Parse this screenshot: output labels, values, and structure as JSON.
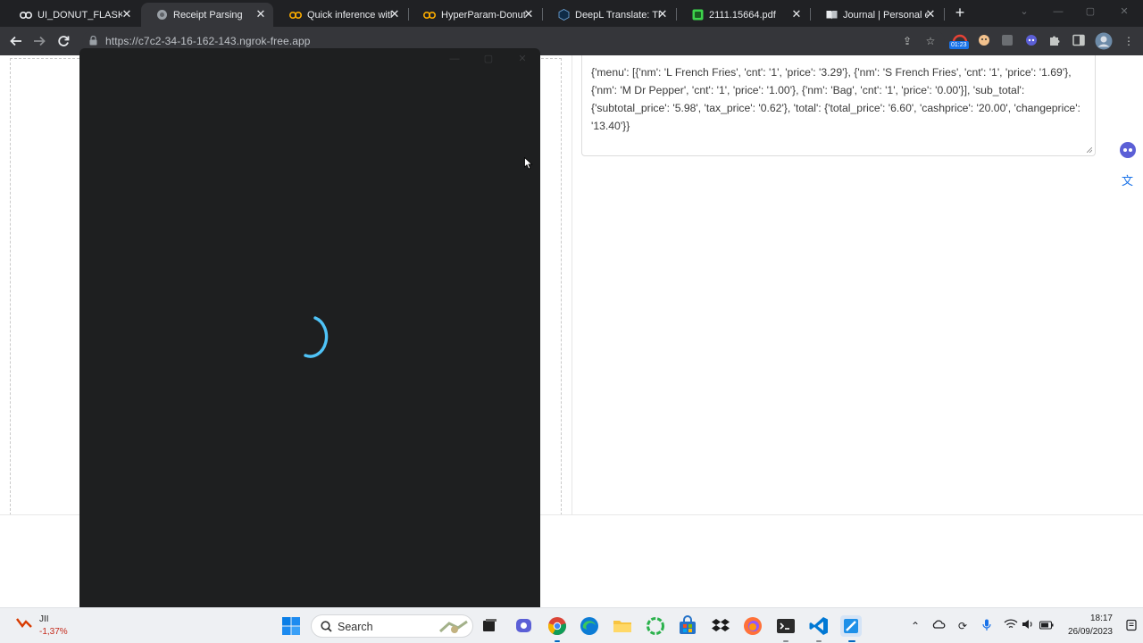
{
  "browser": {
    "tabs": [
      {
        "label": "UI_DONUT_FLASK - C",
        "favicon": "colab-icon",
        "active": false
      },
      {
        "label": "Receipt Parsing",
        "favicon": "globe-icon",
        "active": true
      },
      {
        "label": "Quick inference with I",
        "favicon": "colab-icon",
        "active": false
      },
      {
        "label": "HyperParam-Donut.ip",
        "favicon": "colab-icon",
        "active": false
      },
      {
        "label": "DeepL Translate: The v",
        "favicon": "deepl-icon",
        "active": false
      },
      {
        "label": "2111.15664.pdf",
        "favicon": "pdf-icon",
        "active": false
      },
      {
        "label": "Journal | Personal ent",
        "favicon": "book-icon",
        "active": false
      }
    ],
    "new_tab_label": "+",
    "url": "https://c7c2-34-16-162-143.ngrok-free.app",
    "extension_badge": "01:23",
    "colors": {
      "tabstrip": "#202124",
      "toolbar": "#35363a",
      "accent": "#8ab4f8"
    }
  },
  "result": {
    "text": "{'menu': [{'nm': 'L French Fries', 'cnt': '1', 'price': '3.29'}, {'nm': 'S French Fries', 'cnt': '1', 'price': '1.69'}, {'nm': 'M Dr Pepper', 'cnt': '1', 'price': '1.00'}, {'nm': 'Bag', 'cnt': '1', 'price': '0.00'}], 'sub_total': {'subtotal_price': '5.98', 'tax_price': '0.62'}, 'total': {'total_price': '6.60', 'cashprice': '20.00', 'changeprice': '13.40'}}"
  },
  "picker": {
    "state": "loading",
    "spinner_color": "#4fc3f7",
    "controls": [
      "minimize-icon",
      "maximize-icon",
      "close-icon"
    ]
  },
  "taskbar": {
    "stock_name": "JII",
    "stock_change": "-1,37%",
    "search_label": "Search",
    "time": "18:17",
    "date": "26/09/2023",
    "apps": [
      "start-icon",
      "search",
      "widgets-icon",
      "task-view-icon",
      "teams-icon",
      "chrome-icon",
      "edge-icon",
      "file-explorer-icon",
      "app-icon",
      "store-icon",
      "dropbox-icon",
      "firefox-icon",
      "terminal-icon",
      "vscode-icon",
      "paint-icon"
    ]
  }
}
